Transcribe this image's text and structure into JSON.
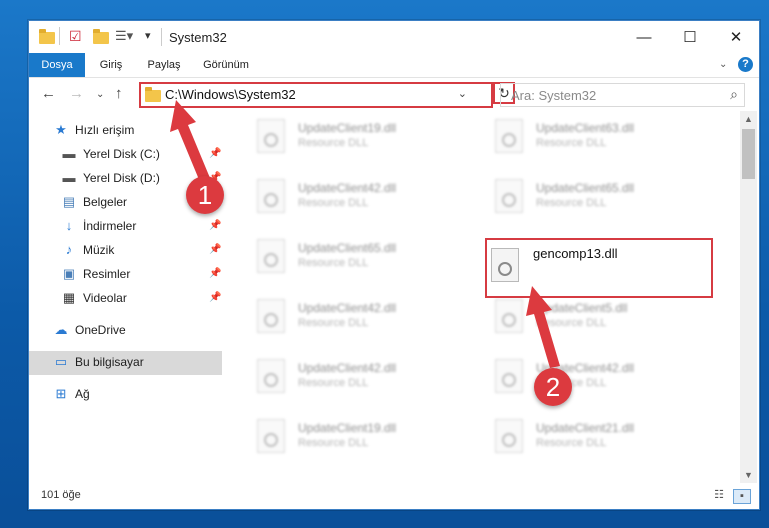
{
  "window": {
    "title": "System32",
    "minimize": "—",
    "maximize": "☐",
    "close": "✕"
  },
  "ribbon": {
    "tabs": [
      "Dosya",
      "Giriş",
      "Paylaş",
      "Görünüm"
    ],
    "help": "?"
  },
  "address": {
    "path": "C:\\Windows\\System32",
    "search_placeholder": "Ara: System32"
  },
  "sidebar": {
    "items": [
      {
        "label": "Hızlı erişim",
        "icon": "star-icon"
      },
      {
        "label": "Yerel Disk (C:)",
        "icon": "drive-icon",
        "pinned": true
      },
      {
        "label": "Yerel Disk (D:)",
        "icon": "drive-icon",
        "pinned": true
      },
      {
        "label": "Belgeler",
        "icon": "documents-icon",
        "pinned": true
      },
      {
        "label": "İndirmeler",
        "icon": "download-icon",
        "pinned": true
      },
      {
        "label": "Müzik",
        "icon": "music-icon",
        "pinned": true
      },
      {
        "label": "Resimler",
        "icon": "pictures-icon",
        "pinned": true
      },
      {
        "label": "Videolar",
        "icon": "videos-icon",
        "pinned": true
      },
      {
        "label": "OneDrive",
        "icon": "cloud-icon"
      },
      {
        "label": "Bu bilgisayar",
        "icon": "computer-icon",
        "selected": true
      },
      {
        "label": "Ağ",
        "icon": "network-icon"
      }
    ]
  },
  "files": {
    "left": [
      {
        "name": "UpdateClient19.dll",
        "desc": "Resource DLL"
      },
      {
        "name": "UpdateClient42.dll",
        "desc": "Resource DLL"
      },
      {
        "name": "UpdateClient65.dll",
        "desc": "Resource DLL"
      },
      {
        "name": "UpdateClient42.dll",
        "desc": "Resource DLL"
      },
      {
        "name": "UpdateClient42.dll",
        "desc": "Resource DLL"
      },
      {
        "name": "UpdateClient19.dll",
        "desc": "Resource DLL"
      }
    ],
    "right": [
      {
        "name": "UpdateClient63.dll",
        "desc": "Resource DLL"
      },
      {
        "name": "UpdateClient65.dll",
        "desc": "Resource DLL"
      },
      {
        "name": "UpdateClient5.dll",
        "desc": "Resource DLL"
      },
      {
        "name": "UpdateClient42.dll",
        "desc": "Resource DLL"
      },
      {
        "name": "UpdateClient21.dll",
        "desc": "Resource DLL"
      }
    ],
    "highlighted": {
      "name": "gencomp13.dll"
    }
  },
  "status": {
    "count": "101 öğe"
  },
  "callouts": {
    "one": "1",
    "two": "2",
    "color": "#dc3a3f"
  }
}
